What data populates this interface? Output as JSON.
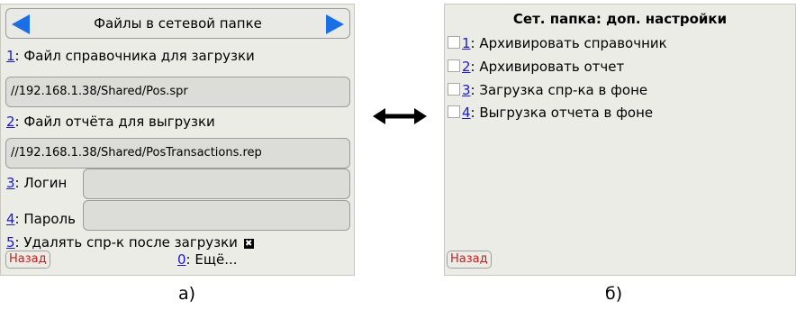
{
  "panel_a": {
    "title": "Файлы в сетевой папке",
    "item1": {
      "num": "1",
      "label": ": Файл справочника для загрузки",
      "value": "//192.168.1.38/Shared/Pos.spr"
    },
    "item2": {
      "num": "2",
      "label": ": Файл отчёта для выгрузки",
      "value": "//192.168.1.38/Shared/PosTransactions.rep"
    },
    "item3": {
      "num": "3",
      "label": ": Логин",
      "value": ""
    },
    "item4": {
      "num": "4",
      "label": ": Пароль",
      "value": ""
    },
    "item5": {
      "num": "5",
      "label": ": Удалять спр-к после загрузки",
      "checkbox_glyph": "✖",
      "checked": true
    },
    "back": "Назад",
    "more": {
      "num": "0",
      "label": ": Ещё..."
    }
  },
  "panel_b": {
    "title": "Сет. папка: доп. настройки",
    "options": [
      {
        "num": "1",
        "label": ": Архивировать справочник",
        "checked": false
      },
      {
        "num": "2",
        "label": ": Архивировать отчет",
        "checked": false
      },
      {
        "num": "3",
        "label": ": Загрузка спр-ка в фоне",
        "checked": false
      },
      {
        "num": "4",
        "label": ": Выгрузка отчета в фоне",
        "checked": false
      }
    ],
    "back": "Назад"
  },
  "captions": {
    "a": "а)",
    "b": "б)"
  },
  "colors": {
    "panel_bg": "#ecece6",
    "accent_arrow": "#1a6ee6",
    "link": "#1a1acc",
    "back_text": "#d01818"
  },
  "icons": {
    "left": "arrow-left-icon",
    "right": "arrow-right-icon",
    "between": "double-arrow-icon"
  }
}
